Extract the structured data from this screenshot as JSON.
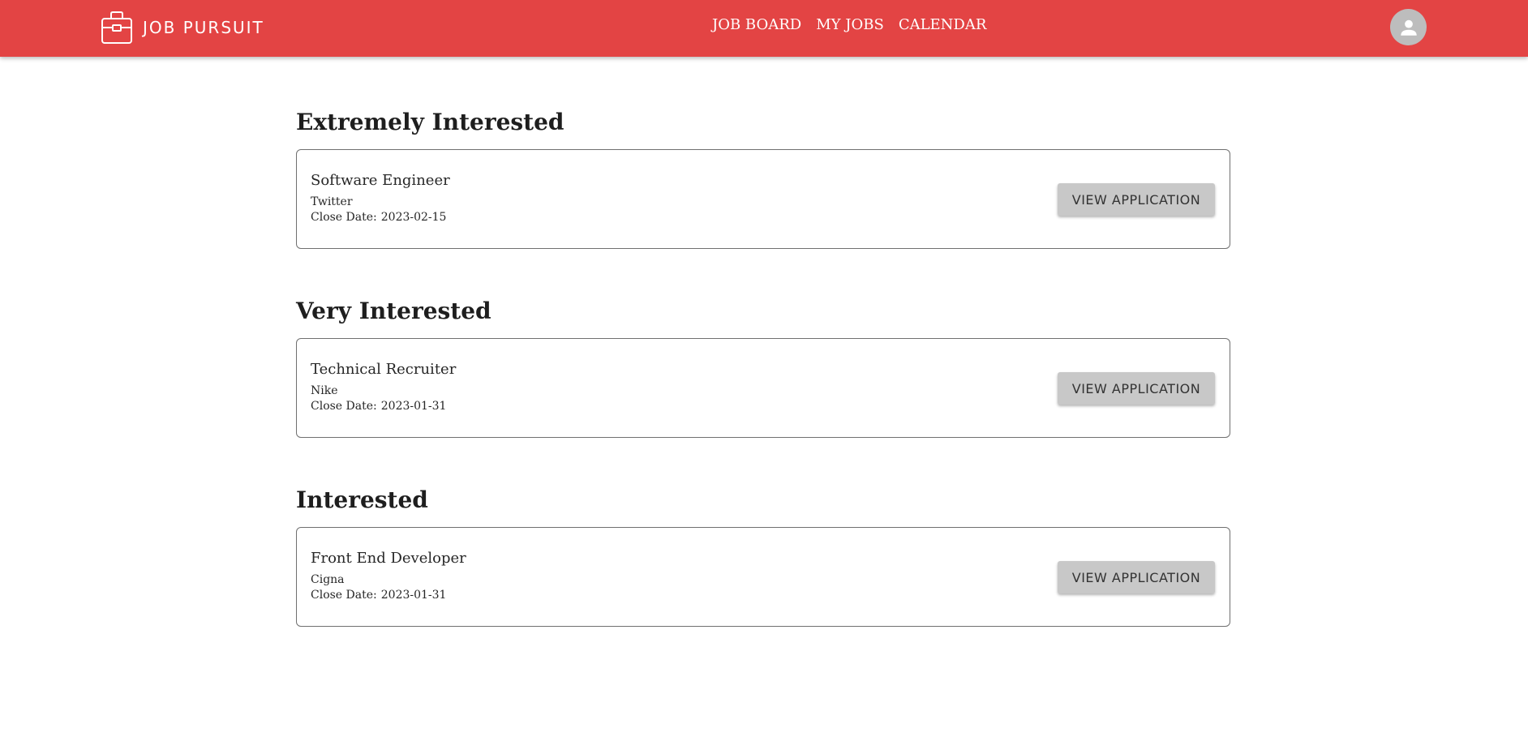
{
  "app": {
    "name": "JOB PURSUIT",
    "logo_icon": "briefcase-icon"
  },
  "nav": {
    "items": [
      {
        "label": "JOB BOARD"
      },
      {
        "label": "MY JOBS"
      },
      {
        "label": "CALENDAR"
      }
    ]
  },
  "user": {
    "avatar_icon": "user-avatar-icon"
  },
  "colors": {
    "header_bg": "#e34444",
    "button_bg": "#c8c8c8",
    "card_border": "#707070"
  },
  "sections": [
    {
      "title": "Extremely Interested",
      "jobs": [
        {
          "title": "Software Engineer",
          "company": "Twitter",
          "close_label": "Close Date:",
          "close_date": "2023-02-15",
          "button_label": "VIEW APPLICATION"
        }
      ]
    },
    {
      "title": "Very Interested",
      "jobs": [
        {
          "title": "Technical Recruiter",
          "company": "Nike",
          "close_label": "Close Date:",
          "close_date": "2023-01-31",
          "button_label": "VIEW APPLICATION"
        }
      ]
    },
    {
      "title": "Interested",
      "jobs": [
        {
          "title": "Front End Developer",
          "company": "Cigna",
          "close_label": "Close Date:",
          "close_date": "2023-01-31",
          "button_label": "VIEW APPLICATION"
        }
      ]
    }
  ]
}
